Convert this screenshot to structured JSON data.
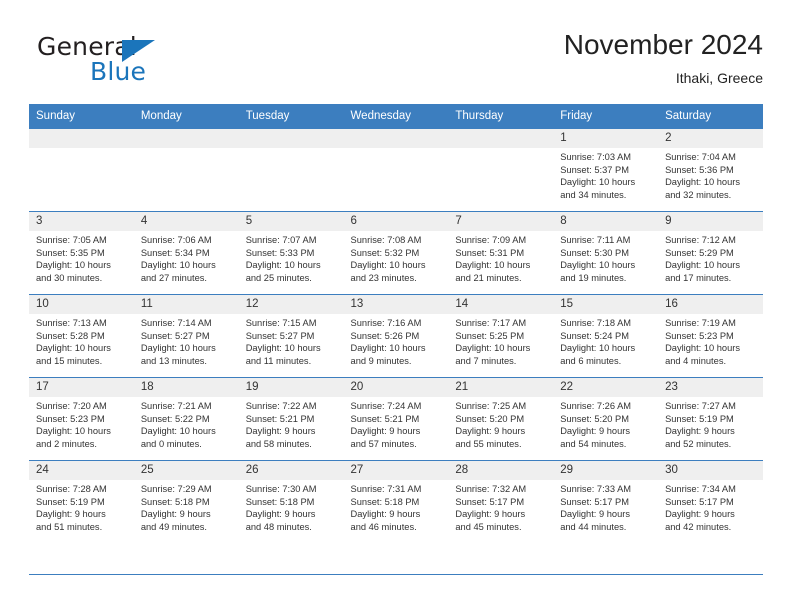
{
  "brand": {
    "name_part1": "General",
    "name_part2": "Blue",
    "accent_color": "#1b75bb"
  },
  "header": {
    "title": "November 2024",
    "location": "Ithaki, Greece"
  },
  "theme": {
    "header_row_bg": "#3c7ebf",
    "day_band_bg": "#efefef",
    "grid_line": "#3c7ebf",
    "text": "#333333"
  },
  "weekday_headers": [
    "Sunday",
    "Monday",
    "Tuesday",
    "Wednesday",
    "Thursday",
    "Friday",
    "Saturday"
  ],
  "weeks": [
    [
      {
        "day": "",
        "lines": []
      },
      {
        "day": "",
        "lines": []
      },
      {
        "day": "",
        "lines": []
      },
      {
        "day": "",
        "lines": []
      },
      {
        "day": "",
        "lines": []
      },
      {
        "day": "1",
        "lines": [
          "Sunrise: 7:03 AM",
          "Sunset: 5:37 PM",
          "Daylight: 10 hours",
          "and 34 minutes."
        ]
      },
      {
        "day": "2",
        "lines": [
          "Sunrise: 7:04 AM",
          "Sunset: 5:36 PM",
          "Daylight: 10 hours",
          "and 32 minutes."
        ]
      }
    ],
    [
      {
        "day": "3",
        "lines": [
          "Sunrise: 7:05 AM",
          "Sunset: 5:35 PM",
          "Daylight: 10 hours",
          "and 30 minutes."
        ]
      },
      {
        "day": "4",
        "lines": [
          "Sunrise: 7:06 AM",
          "Sunset: 5:34 PM",
          "Daylight: 10 hours",
          "and 27 minutes."
        ]
      },
      {
        "day": "5",
        "lines": [
          "Sunrise: 7:07 AM",
          "Sunset: 5:33 PM",
          "Daylight: 10 hours",
          "and 25 minutes."
        ]
      },
      {
        "day": "6",
        "lines": [
          "Sunrise: 7:08 AM",
          "Sunset: 5:32 PM",
          "Daylight: 10 hours",
          "and 23 minutes."
        ]
      },
      {
        "day": "7",
        "lines": [
          "Sunrise: 7:09 AM",
          "Sunset: 5:31 PM",
          "Daylight: 10 hours",
          "and 21 minutes."
        ]
      },
      {
        "day": "8",
        "lines": [
          "Sunrise: 7:11 AM",
          "Sunset: 5:30 PM",
          "Daylight: 10 hours",
          "and 19 minutes."
        ]
      },
      {
        "day": "9",
        "lines": [
          "Sunrise: 7:12 AM",
          "Sunset: 5:29 PM",
          "Daylight: 10 hours",
          "and 17 minutes."
        ]
      }
    ],
    [
      {
        "day": "10",
        "lines": [
          "Sunrise: 7:13 AM",
          "Sunset: 5:28 PM",
          "Daylight: 10 hours",
          "and 15 minutes."
        ]
      },
      {
        "day": "11",
        "lines": [
          "Sunrise: 7:14 AM",
          "Sunset: 5:27 PM",
          "Daylight: 10 hours",
          "and 13 minutes."
        ]
      },
      {
        "day": "12",
        "lines": [
          "Sunrise: 7:15 AM",
          "Sunset: 5:27 PM",
          "Daylight: 10 hours",
          "and 11 minutes."
        ]
      },
      {
        "day": "13",
        "lines": [
          "Sunrise: 7:16 AM",
          "Sunset: 5:26 PM",
          "Daylight: 10 hours",
          "and 9 minutes."
        ]
      },
      {
        "day": "14",
        "lines": [
          "Sunrise: 7:17 AM",
          "Sunset: 5:25 PM",
          "Daylight: 10 hours",
          "and 7 minutes."
        ]
      },
      {
        "day": "15",
        "lines": [
          "Sunrise: 7:18 AM",
          "Sunset: 5:24 PM",
          "Daylight: 10 hours",
          "and 6 minutes."
        ]
      },
      {
        "day": "16",
        "lines": [
          "Sunrise: 7:19 AM",
          "Sunset: 5:23 PM",
          "Daylight: 10 hours",
          "and 4 minutes."
        ]
      }
    ],
    [
      {
        "day": "17",
        "lines": [
          "Sunrise: 7:20 AM",
          "Sunset: 5:23 PM",
          "Daylight: 10 hours",
          "and 2 minutes."
        ]
      },
      {
        "day": "18",
        "lines": [
          "Sunrise: 7:21 AM",
          "Sunset: 5:22 PM",
          "Daylight: 10 hours",
          "and 0 minutes."
        ]
      },
      {
        "day": "19",
        "lines": [
          "Sunrise: 7:22 AM",
          "Sunset: 5:21 PM",
          "Daylight: 9 hours",
          "and 58 minutes."
        ]
      },
      {
        "day": "20",
        "lines": [
          "Sunrise: 7:24 AM",
          "Sunset: 5:21 PM",
          "Daylight: 9 hours",
          "and 57 minutes."
        ]
      },
      {
        "day": "21",
        "lines": [
          "Sunrise: 7:25 AM",
          "Sunset: 5:20 PM",
          "Daylight: 9 hours",
          "and 55 minutes."
        ]
      },
      {
        "day": "22",
        "lines": [
          "Sunrise: 7:26 AM",
          "Sunset: 5:20 PM",
          "Daylight: 9 hours",
          "and 54 minutes."
        ]
      },
      {
        "day": "23",
        "lines": [
          "Sunrise: 7:27 AM",
          "Sunset: 5:19 PM",
          "Daylight: 9 hours",
          "and 52 minutes."
        ]
      }
    ],
    [
      {
        "day": "24",
        "lines": [
          "Sunrise: 7:28 AM",
          "Sunset: 5:19 PM",
          "Daylight: 9 hours",
          "and 51 minutes."
        ]
      },
      {
        "day": "25",
        "lines": [
          "Sunrise: 7:29 AM",
          "Sunset: 5:18 PM",
          "Daylight: 9 hours",
          "and 49 minutes."
        ]
      },
      {
        "day": "26",
        "lines": [
          "Sunrise: 7:30 AM",
          "Sunset: 5:18 PM",
          "Daylight: 9 hours",
          "and 48 minutes."
        ]
      },
      {
        "day": "27",
        "lines": [
          "Sunrise: 7:31 AM",
          "Sunset: 5:18 PM",
          "Daylight: 9 hours",
          "and 46 minutes."
        ]
      },
      {
        "day": "28",
        "lines": [
          "Sunrise: 7:32 AM",
          "Sunset: 5:17 PM",
          "Daylight: 9 hours",
          "and 45 minutes."
        ]
      },
      {
        "day": "29",
        "lines": [
          "Sunrise: 7:33 AM",
          "Sunset: 5:17 PM",
          "Daylight: 9 hours",
          "and 44 minutes."
        ]
      },
      {
        "day": "30",
        "lines": [
          "Sunrise: 7:34 AM",
          "Sunset: 5:17 PM",
          "Daylight: 9 hours",
          "and 42 minutes."
        ]
      }
    ]
  ]
}
